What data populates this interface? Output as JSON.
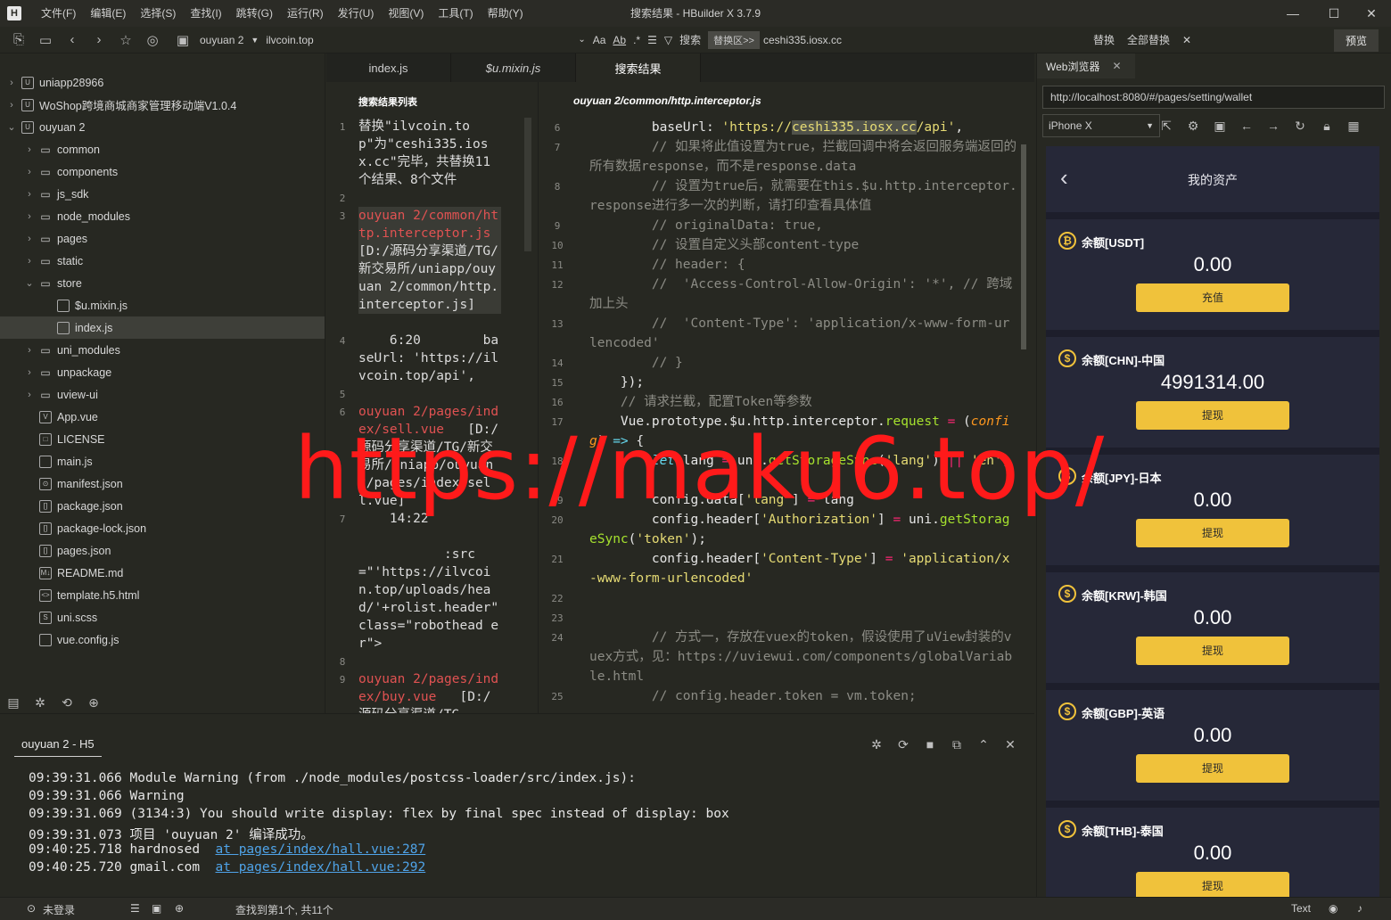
{
  "window": {
    "title": "搜索结果 - HBuilder X 3.7.9",
    "logo": "H",
    "menu": [
      "文件(F)",
      "编辑(E)",
      "选择(S)",
      "查找(I)",
      "跳转(G)",
      "运行(R)",
      "发行(U)",
      "视图(V)",
      "工具(T)",
      "帮助(Y)"
    ]
  },
  "toolbar": {
    "project": "ouyuan 2",
    "search_text": "ilvcoin.top",
    "option_aa": "Aa",
    "option_ab": "Ab",
    "search_label": "搜索",
    "replace_area": "替换区>>",
    "replace_text": "ceshi335.iosx.cc",
    "replace_label": "替换",
    "replace_all_label": "全部替换",
    "preview_label": "预览"
  },
  "tree": [
    {
      "label": "uniapp28966",
      "depth": 0,
      "arrow": "›",
      "icon": "U"
    },
    {
      "label": "WoShop跨境商城商家管理移动端V1.0.4",
      "depth": 0,
      "arrow": "›",
      "icon": "U"
    },
    {
      "label": "ouyuan 2",
      "depth": 0,
      "arrow": "⌄",
      "icon": "U"
    },
    {
      "label": "common",
      "depth": 1,
      "arrow": "›",
      "icon": "folder"
    },
    {
      "label": "components",
      "depth": 1,
      "arrow": "›",
      "icon": "folder"
    },
    {
      "label": "js_sdk",
      "depth": 1,
      "arrow": "›",
      "icon": "folder"
    },
    {
      "label": "node_modules",
      "depth": 1,
      "arrow": "›",
      "icon": "folder"
    },
    {
      "label": "pages",
      "depth": 1,
      "arrow": "›",
      "icon": "folder"
    },
    {
      "label": "static",
      "depth": 1,
      "arrow": "›",
      "icon": "folder"
    },
    {
      "label": "store",
      "depth": 1,
      "arrow": "⌄",
      "icon": "folder"
    },
    {
      "label": "$u.mixin.js",
      "depth": 2,
      "arrow": "",
      "icon": "js"
    },
    {
      "label": "index.js",
      "depth": 2,
      "arrow": "",
      "icon": "js",
      "selected": true
    },
    {
      "label": "uni_modules",
      "depth": 1,
      "arrow": "›",
      "icon": "folder"
    },
    {
      "label": "unpackage",
      "depth": 1,
      "arrow": "›",
      "icon": "folder"
    },
    {
      "label": "uview-ui",
      "depth": 1,
      "arrow": "›",
      "icon": "folder"
    },
    {
      "label": "App.vue",
      "depth": 1,
      "arrow": "",
      "icon": "V"
    },
    {
      "label": "LICENSE",
      "depth": 1,
      "arrow": "",
      "icon": "□"
    },
    {
      "label": "main.js",
      "depth": 1,
      "arrow": "",
      "icon": "js"
    },
    {
      "label": "manifest.json",
      "depth": 1,
      "arrow": "",
      "icon": "⊙"
    },
    {
      "label": "package.json",
      "depth": 1,
      "arrow": "",
      "icon": "[]"
    },
    {
      "label": "package-lock.json",
      "depth": 1,
      "arrow": "",
      "icon": "[]"
    },
    {
      "label": "pages.json",
      "depth": 1,
      "arrow": "",
      "icon": "[]"
    },
    {
      "label": "README.md",
      "depth": 1,
      "arrow": "",
      "icon": "M↓"
    },
    {
      "label": "template.h5.html",
      "depth": 1,
      "arrow": "",
      "icon": "<>"
    },
    {
      "label": "uni.scss",
      "depth": 1,
      "arrow": "",
      "icon": "S"
    },
    {
      "label": "vue.config.js",
      "depth": 1,
      "arrow": "",
      "icon": "js"
    }
  ],
  "editor_tabs": [
    {
      "label": "index.js",
      "italic": false,
      "active": false
    },
    {
      "label": "$u.mixin.js",
      "italic": true,
      "active": false
    },
    {
      "label": "搜索结果",
      "italic": false,
      "active": true
    }
  ],
  "search_pane": {
    "title": "搜索结果列表",
    "lines": [
      {
        "ln": "1",
        "text": "替换\"ilvcoin.top\"为\"ceshi335.iosx.cc\"完毕，共替换11个结果、8个文件",
        "color": "normal"
      },
      {
        "ln": "2",
        "text": "",
        "color": "normal"
      },
      {
        "ln": "3",
        "text": "ouyuan 2/common/http.interceptor.js",
        "color": "red",
        "suffix": " [D:/源码分享渠道/TG/新交易所/uniapp/ouyuan 2/common/http.interceptor.js]"
      },
      {
        "ln": "4",
        "text": "    6:20        baseUrl: 'https://ilvcoin.top/api',",
        "color": "normal"
      },
      {
        "ln": "5",
        "text": "",
        "color": "normal"
      },
      {
        "ln": "6",
        "text": "ouyuan 2/pages/index/sell.vue",
        "color": "red",
        "suffix": "   [D:/源码分享渠道/TG/新交易所/uniapp/ouyuan 2/pages/index/sell.vue]"
      },
      {
        "ln": "7",
        "text": "    14:22",
        "color": "normal"
      },
      {
        "ln": "",
        "text": "           :src=\"'https://ilvcoin.top/uploads/head/'+rolist.header\" class=\"robothead er\">",
        "color": "normal"
      },
      {
        "ln": "8",
        "text": "",
        "color": "normal"
      },
      {
        "ln": "9",
        "text": "ouyuan 2/pages/index/buy.vue",
        "color": "red",
        "suffix": "   [D:/源码分享渠道/TG"
      }
    ]
  },
  "code_pane": {
    "file_path": "ouyuan 2/common/http.interceptor.js",
    "lines": [
      {
        "ln": "6",
        "html": "        baseUrl: <span class=\"c-str\">'https://<span class=\"mark\">ceshi335.iosx.cc</span>/api'</span>,"
      },
      {
        "ln": "7",
        "html": "<span class=\"c-cmt\">        // 如果将此值设置为true，拦截回调中将会返回服务端返回的所有数据response，而不是response.data</span>"
      },
      {
        "ln": "8",
        "html": "<span class=\"c-cmt\">        // 设置为true后，就需要在this.$u.http.interceptor.response进行多一次的判断，请打印查看具体值</span>"
      },
      {
        "ln": "9",
        "html": "<span class=\"c-cmt\">        // originalData: true,</span>"
      },
      {
        "ln": "10",
        "html": "<span class=\"c-cmt\">        // 设置自定义头部content-type</span>"
      },
      {
        "ln": "11",
        "html": "<span class=\"c-cmt\">        // header: {</span>"
      },
      {
        "ln": "12",
        "html": "<span class=\"c-cmt\">        //  'Access-Control-Allow-Origin': '*', // 跨域加上头</span>"
      },
      {
        "ln": "13",
        "html": "<span class=\"c-cmt\">        //  'Content-Type': 'application/x-www-form-urlencoded'</span>"
      },
      {
        "ln": "14",
        "html": "<span class=\"c-cmt\">        // }</span>"
      },
      {
        "ln": "15",
        "html": "    });"
      },
      {
        "ln": "16",
        "html": "<span class=\"c-cmt\">    // 请求拦截，配置Token等参数</span>"
      },
      {
        "ln": "17",
        "html": "    Vue.prototype.$u.http.interceptor.<span class=\"c-fn\">request</span> <span class=\"c-op\">=</span> (<span class=\"c-param\">config</span>) <span class=\"c-kw\">=&gt;</span> {"
      },
      {
        "ln": "18",
        "html": "        <span class=\"c-kw\">let</span> lang <span class=\"c-op\">=</span> uni.<span class=\"c-fn\">getStorageSync</span>(<span class=\"c-str\">'lang'</span>) <span class=\"c-op\">||</span> <span class=\"c-str\">'en'</span>;"
      },
      {
        "ln": "19",
        "html": "        config.data[<span class=\"c-str\">'lang'</span>] <span class=\"c-op\">=</span> lang"
      },
      {
        "ln": "20",
        "html": "        config.header[<span class=\"c-str\">'Authorization'</span>] <span class=\"c-op\">=</span> uni.<span class=\"c-fn\">getStorageSync</span>(<span class=\"c-str\">'token'</span>);"
      },
      {
        "ln": "21",
        "html": "        config.header[<span class=\"c-str\">'Content-Type'</span>] <span class=\"c-op\">=</span> <span class=\"c-str\">'application/x-www-form-urlencoded'</span>"
      },
      {
        "ln": "22",
        "html": ""
      },
      {
        "ln": "23",
        "html": ""
      },
      {
        "ln": "24",
        "html": "<span class=\"c-cmt\">        // 方式一，存放在vuex的token，假设使用了uView封装的vuex方式，见：https://uviewui.com/components/globalVariable.html</span>"
      },
      {
        "ln": "25",
        "html": "<span class=\"c-cmt\">        // config.header.token = vm.token;</span>"
      }
    ]
  },
  "browser": {
    "tab_label": "Web浏览器",
    "url": "http://localhost:8080/#/pages/setting/wallet",
    "device": "iPhone X",
    "page_title": "我的资产",
    "assets": [
      {
        "name": "余额[USDT]",
        "value": "0.00",
        "button": "充值",
        "coin": "₿"
      },
      {
        "name": "余额[CHN]-中国",
        "value": "4991314.00",
        "button": "提现",
        "coin": "$"
      },
      {
        "name": "余额[JPY]-日本",
        "value": "0.00",
        "button": "提现",
        "coin": "$"
      },
      {
        "name": "余额[KRW]-韩国",
        "value": "0.00",
        "button": "提现",
        "coin": "$"
      },
      {
        "name": "余额[GBP]-英语",
        "value": "0.00",
        "button": "提现",
        "coin": "$"
      },
      {
        "name": "余额[THB]-泰国",
        "value": "0.00",
        "button": "提现",
        "coin": "$"
      }
    ]
  },
  "console": {
    "tab_label": "ouyuan 2 - H5",
    "lines": [
      {
        "text": "09:39:31.066 Module Warning (from ./node_modules/postcss-loader/src/index.js):",
        "link": ""
      },
      {
        "text": "09:39:31.066 Warning",
        "link": ""
      },
      {
        "text": "09:39:31.069 (3134:3) You should write display: flex by final spec instead of display: box",
        "link": ""
      },
      {
        "text": "09:39:31.073 项目 'ouyuan 2' 编译成功。",
        "link": ""
      },
      {
        "text": "09:40:25.718 hardnosed  ",
        "link": "at pages/index/hall.vue:287"
      },
      {
        "text": "09:40:25.720 gmail.com  ",
        "link": "at pages/index/hall.vue:292"
      }
    ]
  },
  "statusbar": {
    "login": "未登录",
    "find_result": "查找到第1个, 共11个",
    "mode": "Text"
  },
  "watermark": "https://maku6.top/",
  "colors": {
    "background": "#272822",
    "accent_yellow": "#f0c23b",
    "watermark_red": "#ff1a1a"
  }
}
